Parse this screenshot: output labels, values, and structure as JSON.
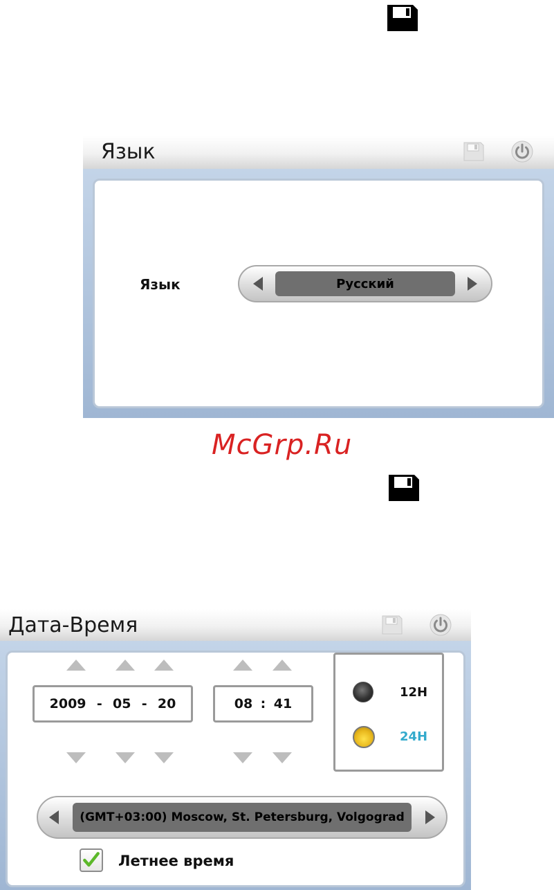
{
  "watermark": "McGrp.Ru",
  "language_window": {
    "title": "Язык",
    "label": "Язык",
    "value": "Русский"
  },
  "datetime_window": {
    "title": "Дата-Время",
    "date": {
      "year": "2009",
      "month": "05",
      "day": "20",
      "separator": "-"
    },
    "time": {
      "hour": "08",
      "minute": "41",
      "separator": ":"
    },
    "format_options": [
      {
        "label": "12H",
        "selected": false,
        "color": "#111111"
      },
      {
        "label": "24H",
        "selected": true,
        "color": "#33aacc"
      }
    ],
    "timezone": "(GMT+03:00) Moscow, St. Petersburg, Volgograd",
    "dst": {
      "label": "Летнее время",
      "checked": true
    }
  },
  "icons": {
    "save": "floppy-disk-icon",
    "power": "power-icon",
    "check": "checkmark-icon"
  }
}
